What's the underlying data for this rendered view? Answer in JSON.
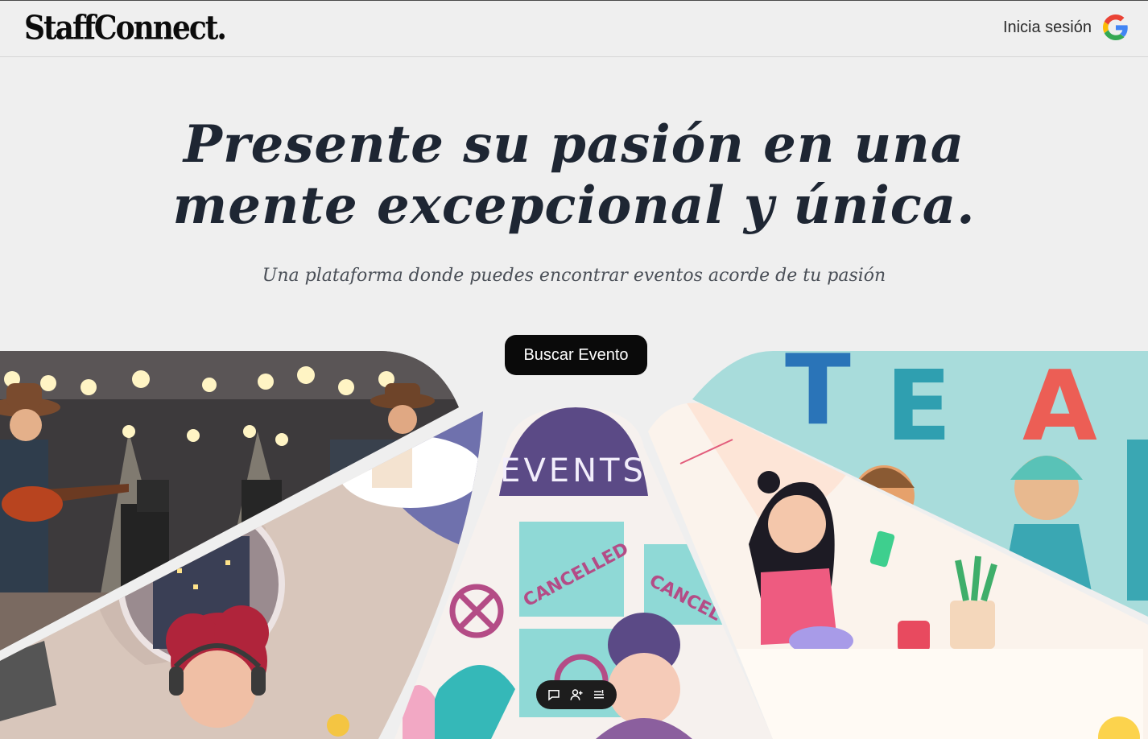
{
  "header": {
    "logo_text": "StaffConnect.",
    "login_label": "Inicia sesión",
    "login_icon": "google-icon"
  },
  "hero": {
    "title_line1": "Presente su pasión en una",
    "title_line2": "mente excepcional y única.",
    "subtitle": "Una plataforma donde puedes encontrar eventos acorde de tu pasión",
    "cta_label": "Buscar Evento"
  },
  "collage": {
    "events_sign": "EVENTS",
    "cancelled_1": "CANCELLED",
    "cancelled_2": "CANCEL",
    "team_letters": [
      "T",
      "E",
      "A"
    ]
  },
  "toolbar": {
    "icons": [
      "chat-icon",
      "add-user-icon",
      "menu-icon"
    ]
  },
  "colors": {
    "background": "#efefef",
    "title": "#1e2633",
    "cta_background": "#0a0a0a",
    "teal": "#8fd9d6",
    "purple": "#5b4a86"
  }
}
